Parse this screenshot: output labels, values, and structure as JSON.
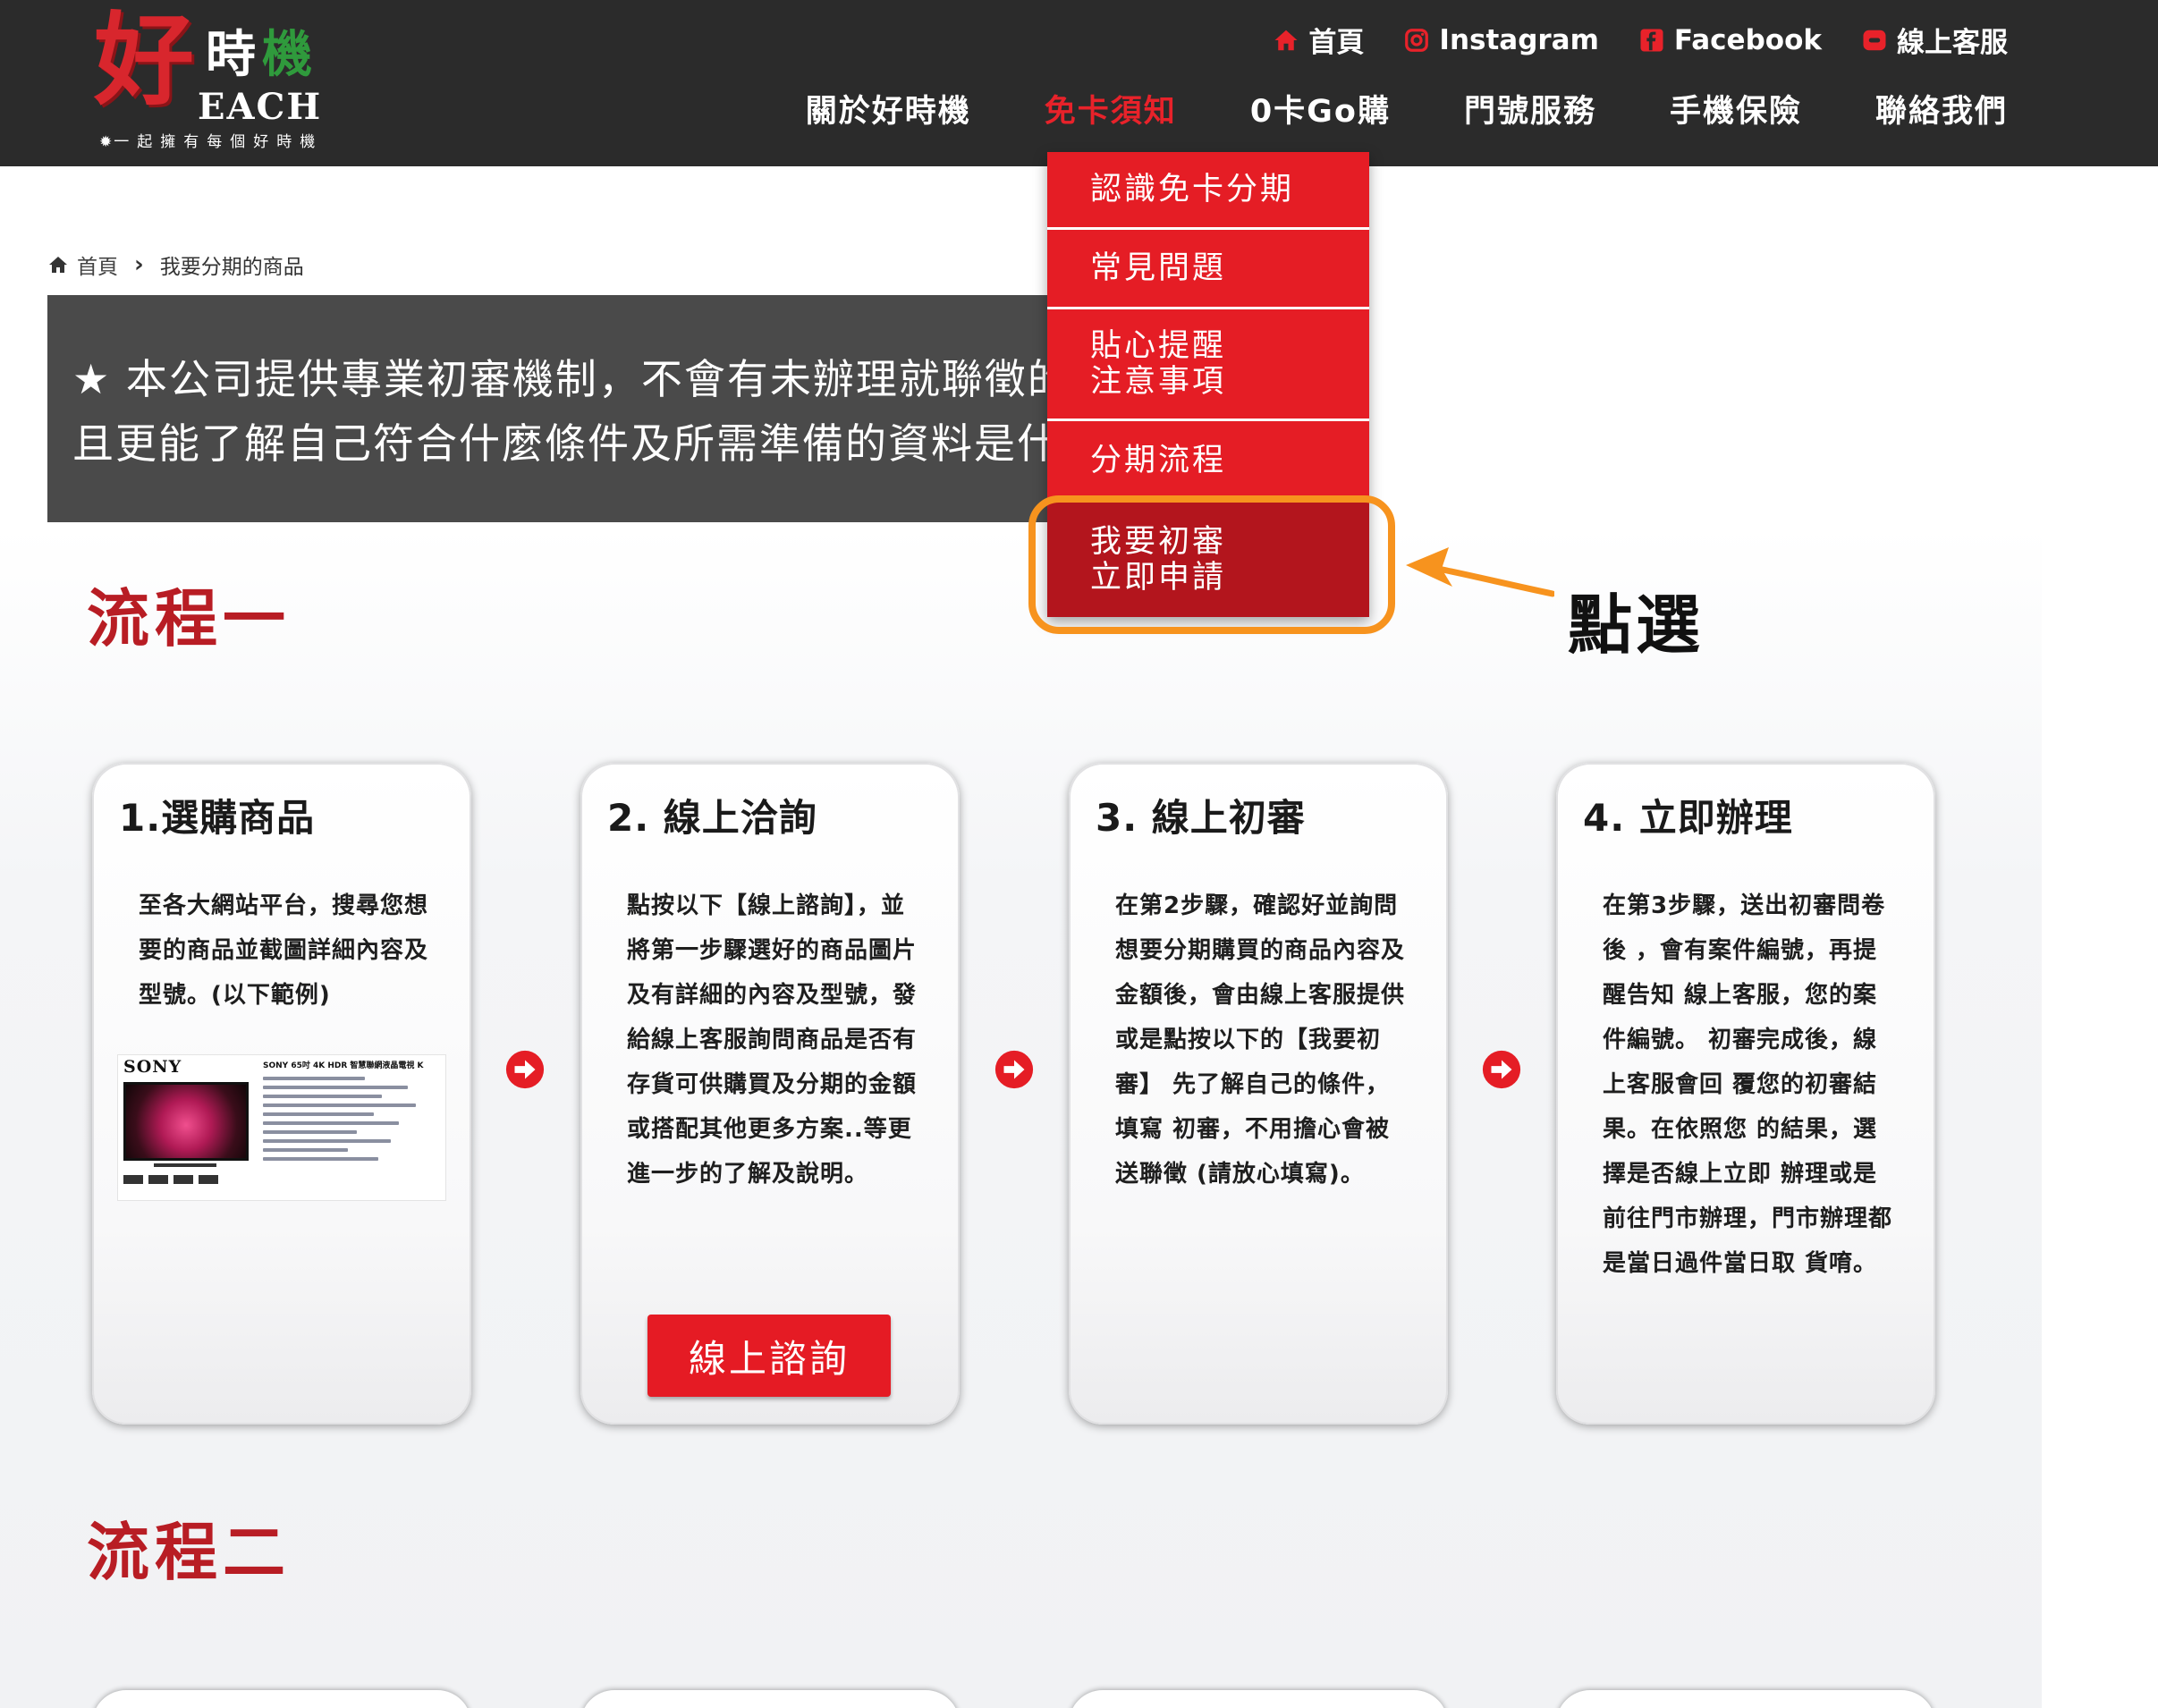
{
  "logo": {
    "char_hao": "好",
    "char_shi": "時",
    "char_ji": "機",
    "each": "EACH",
    "slogan": "一起擁有每個好時機"
  },
  "top_links": [
    {
      "label": "首頁",
      "icon": "home-icon"
    },
    {
      "label": "Instagram",
      "icon": "instagram-icon"
    },
    {
      "label": "Facebook",
      "icon": "facebook-icon"
    },
    {
      "label": "線上客服",
      "icon": "chat-icon"
    }
  ],
  "main_nav": [
    {
      "label": "關於好時機",
      "active": false
    },
    {
      "label": "免卡須知",
      "active": true
    },
    {
      "label": "0卡Go購",
      "active": false
    },
    {
      "label": "門號服務",
      "active": false
    },
    {
      "label": "手機保險",
      "active": false
    },
    {
      "label": "聯絡我們",
      "active": false
    }
  ],
  "dropdown": {
    "items": [
      {
        "line1": "認識免卡分期"
      },
      {
        "line1": "常見問題"
      },
      {
        "line1": "貼心提醒",
        "line2": "注意事項"
      },
      {
        "line1": "分期流程"
      },
      {
        "line1": "我要初審",
        "line2": "立即申請",
        "highlighted": true
      }
    ]
  },
  "annotation": {
    "text": "點選",
    "color": "#f7931e"
  },
  "breadcrumb": {
    "home": "首頁",
    "current": "我要分期的商品"
  },
  "notice": {
    "line1": "★ 本公司提供專業初審機制，不會有未辦理就聯徵的",
    "line2": "且更能了解自己符合什麼條件及所需準備的資料是什"
  },
  "sections": [
    {
      "title": "流程一"
    },
    {
      "title": "流程二"
    }
  ],
  "steps": [
    {
      "title": "1.選購商品",
      "body": "至各大網站平台，搜尋您想 要的商品並截圖詳細內容及 型號。(以下範例)"
    },
    {
      "title": "2. 線上洽詢",
      "body": "點按以下【線上諮詢】，並 將第一步驟選好的商品圖片 及有詳細的內容及型號，發 給線上客服詢問商品是否有 存貨可供購買及分期的金額 或搭配其他更多方案..等更 進一步的了解及說明。",
      "button": "線上諮詢"
    },
    {
      "title": "3. 線上初審",
      "body": "在第2步驟，確認好並詢問 想要分期購買的商品內容及 金額後，會由線上客服提供 或是點按以下的【我要初審】 先了解自己的條件，填寫 初審，不用擔心會被送聯徵 (請放心填寫)。"
    },
    {
      "title": "4. 立即辦理",
      "body": "在第3步驟，送出初審問卷後 ，會有案件編號，再提醒告知 線上客服，您的案件編號。 初審完成後，線上客服會回 覆您的初審結果。在依照您 的結果，選擇是否線上立即 辦理或是前往門市辦理，門市辦理都是當日過件當日取 貨唷。"
    }
  ],
  "product_example": {
    "brand": "SONY",
    "title": "SONY 65吋 4K HDR 智慧聯網液晶電視 K"
  },
  "colors": {
    "header_bg": "#2b2b2b",
    "brand_red": "#e51d25",
    "section_title": "#b81d24",
    "highlight_orange": "#f7931e"
  }
}
